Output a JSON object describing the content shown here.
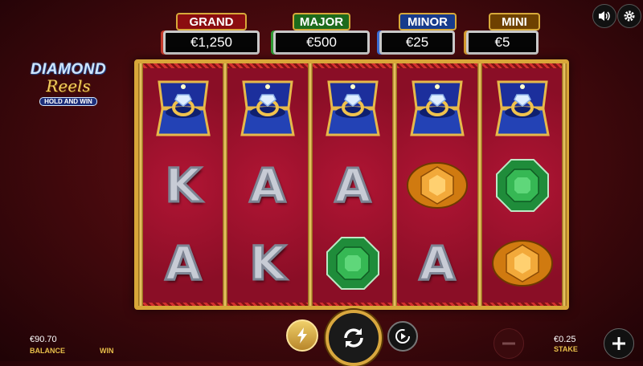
{
  "jackpots": [
    {
      "label": "GRAND",
      "value": "€1,250",
      "color": "#8b0d10"
    },
    {
      "label": "MAJOR",
      "value": "€500",
      "color": "#1d6b1c"
    },
    {
      "label": "MINOR",
      "value": "€25",
      "color": "#173b8c"
    },
    {
      "label": "MINI",
      "value": "€5",
      "color": "#6e4100"
    }
  ],
  "logo": {
    "line1": "DIAMOND",
    "line2": "Reels",
    "line3": "HOLD AND WIN"
  },
  "reels": [
    [
      "ring-box",
      "K",
      "A"
    ],
    [
      "ring-box",
      "A",
      "K"
    ],
    [
      "ring-box",
      "A",
      "emerald"
    ],
    [
      "ring-box",
      "amber",
      "A"
    ],
    [
      "ring-box",
      "emerald",
      "amber"
    ]
  ],
  "footer": {
    "balance_value": "€90.70",
    "balance_label": "BALANCE",
    "win_label": "WIN",
    "stake_value": "€0.25",
    "stake_label": "STAKE"
  },
  "icons": {
    "sound": "speaker-icon",
    "settings": "gear-icon",
    "turbo": "lightning-icon",
    "spin": "spin-arrows-icon",
    "autoplay": "autoplay-icon",
    "minus": "minus-icon",
    "plus": "plus-icon"
  }
}
